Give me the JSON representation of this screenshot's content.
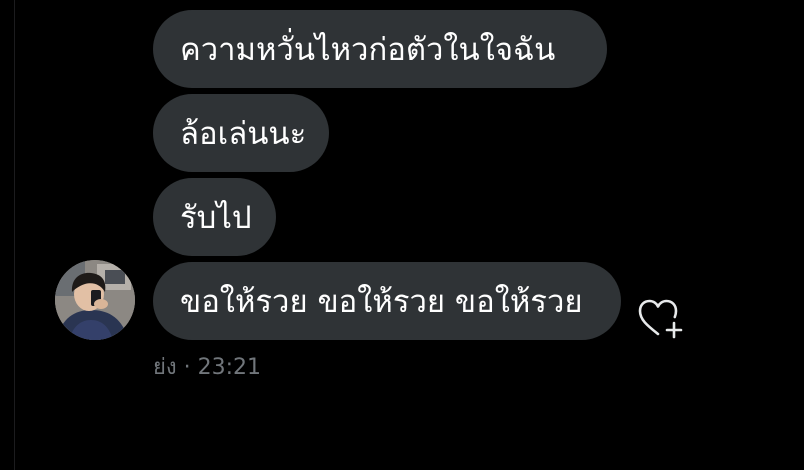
{
  "thread": {
    "messages": [
      {
        "text": "ความหวั่นไหวก่อตัวในใจฉัน"
      },
      {
        "text": "ล้อเล่นนะ"
      },
      {
        "text": "รับไป"
      },
      {
        "text": "ขอให้รวย ขอให้รวย ขอให้รวย"
      }
    ],
    "sender_name": "ย่ง",
    "separator": " · ",
    "time": "23:21"
  },
  "colors": {
    "background": "#000000",
    "bubble": "#2f3336",
    "text": "#ffffff",
    "meta_text": "#71767b"
  },
  "icons": {
    "react": "heart-plus-icon"
  }
}
